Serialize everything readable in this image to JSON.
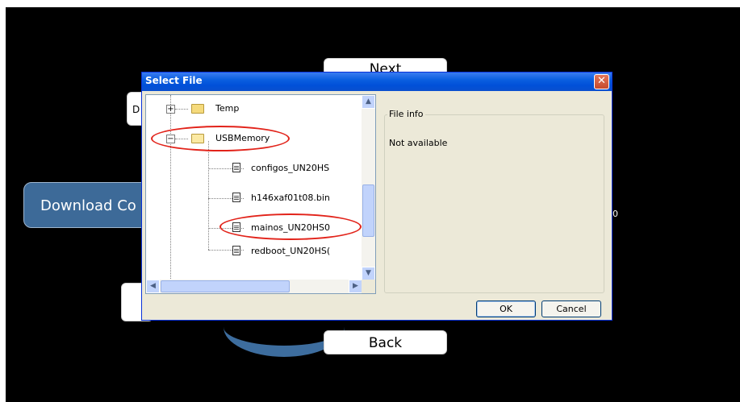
{
  "background": {
    "next_label": "Next",
    "back_label": "Back",
    "download_label": "Download Co",
    "left_top_label": "D",
    "right_stray": "0"
  },
  "dialog": {
    "title": "Select File",
    "close_glyph": "✕",
    "tree": {
      "items": [
        {
          "label": "Temp",
          "type": "folder",
          "expander": "+"
        },
        {
          "label": "USBMemory",
          "type": "folder-open",
          "expander": "−"
        },
        {
          "label": "configos_UN20HS",
          "type": "file"
        },
        {
          "label": "h146xaf01t08.bin",
          "type": "file"
        },
        {
          "label": "mainos_UN20HS0",
          "type": "file"
        },
        {
          "label": "redboot_UN20HS(",
          "type": "file"
        }
      ]
    },
    "file_info": {
      "legend": "File info",
      "value": "Not available"
    },
    "ok_label": "OK",
    "cancel_label": "Cancel"
  },
  "colors": {
    "title_bar": "#0a5ee0",
    "highlight_ring": "#e2231a",
    "download_button": "#3d6a98"
  }
}
